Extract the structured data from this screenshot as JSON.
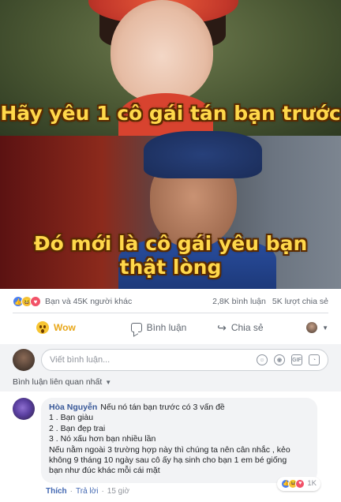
{
  "meme": {
    "caption_top": "Hãy yêu 1 cô gái tán bạn trước",
    "caption_bottom_1": "Đó mới là cô gái yêu bạn",
    "caption_bottom_2": "thật lòng"
  },
  "summary": {
    "reactions_text": "Bạn và 45K người khác",
    "comments_count": "2,8K bình luận",
    "shares_count": "5K lượt chia sẻ",
    "reaction_icons": [
      "like-icon",
      "haha-icon",
      "love-icon"
    ]
  },
  "actions": {
    "wow_label": "Wow",
    "comment_label": "Bình luận",
    "share_label": "Chia sẻ"
  },
  "composer": {
    "placeholder": "Viết bình luận..."
  },
  "sort": {
    "label": "Bình luận liên quan nhất"
  },
  "comment": {
    "author": "Hòa Nguyễn",
    "lines": [
      "Nếu nó tán bạn trước có 3 vấn đề",
      "1 . Bạn giàu",
      "2 . Bạn đẹp trai",
      "3 . Nó xấu hơn bạn nhiều lần",
      "Nếu nằm ngoài 3 trường hợp này thì chúng ta nên cân nhắc , kẻo",
      "không 9 tháng 10 ngày sau cô ấy hạ sinh cho bạn 1 em bé giống",
      "bạn như đúc khác mỗi cái mặt"
    ],
    "reaction_count": "1K",
    "like_label": "Thích",
    "reply_label": "Trả lời",
    "separator": "·",
    "time": "15 giờ"
  },
  "colors": {
    "link": "#385898",
    "caption": "#ffd84a",
    "wow": "#e8a617"
  }
}
